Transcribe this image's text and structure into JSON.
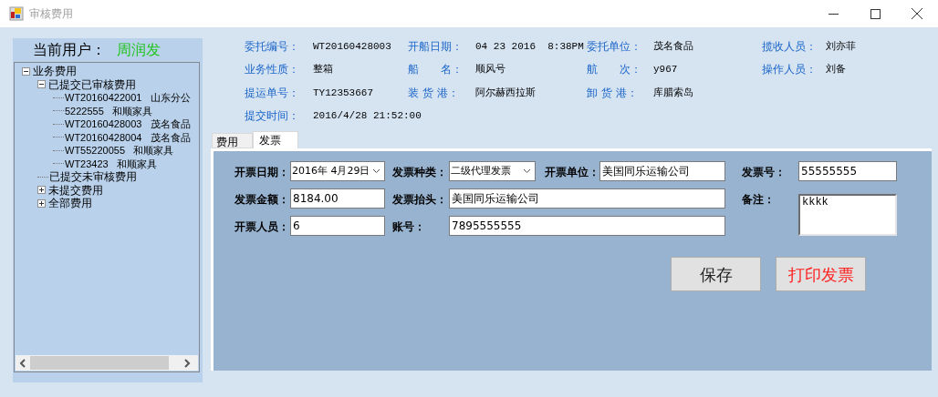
{
  "window": {
    "title": "审核费用"
  },
  "current_user": {
    "label": "当前用户：",
    "name": "周润发"
  },
  "tree": [
    {
      "text": "业务费用",
      "expanded": true,
      "children": [
        {
          "text": "已提交已审核费用",
          "expanded": true,
          "children": [
            {
              "text": "WT20160422001   山东分公"
            },
            {
              "text": "5222555   和顺家具"
            },
            {
              "text": "WT20160428003   茂名食品"
            },
            {
              "text": "WT20160428004   茂名食品"
            },
            {
              "text": "WT55220055   和顺家具"
            },
            {
              "text": "WT23423   和顺家具"
            }
          ]
        },
        {
          "text": "已提交未审核费用"
        },
        {
          "text": "未提交费用",
          "expanded": false
        },
        {
          "text": "全部费用",
          "expanded": false
        }
      ]
    }
  ],
  "info": [
    [
      {
        "label": "委托编号：",
        "value": "WT20160428003"
      },
      {
        "label": "开船日期：",
        "value": "04 23 2016  8:38PM"
      },
      {
        "label": "委托单位：",
        "value": "茂名食品"
      },
      {
        "label": "揽收人员：",
        "value": "刘亦菲"
      }
    ],
    [
      {
        "label": "业务性质：",
        "value": "整箱"
      },
      {
        "label": "船　　名：",
        "value": "顺风号"
      },
      {
        "label": "航　　次：",
        "value": "y967"
      },
      {
        "label": "操作人员：",
        "value": "刘备"
      }
    ],
    [
      {
        "label": "提运单号：",
        "value": "TY12353667"
      },
      {
        "label": "装 货 港：",
        "value": "阿尔赫西拉斯"
      },
      {
        "label": "卸 货 港：",
        "value": "库腊索岛"
      }
    ],
    [
      {
        "label": "提交时间：",
        "value": "2016/4/28 21:52:00"
      }
    ]
  ],
  "tabs": [
    {
      "label": "费用",
      "selected": false
    },
    {
      "label": "发票",
      "selected": true
    }
  ],
  "invoice_form": [
    [
      {
        "label": "开票日期：",
        "value": "2016年 4月29日",
        "kind": "dropdown"
      },
      {
        "label": "发票种类：",
        "value": "二级代理发票",
        "kind": "dropdown"
      },
      {
        "label": "开票单位：",
        "value": "美国同乐运输公司",
        "kind": "text"
      },
      {
        "label": "发票号：",
        "value": "55555555",
        "kind": "text"
      }
    ],
    [
      {
        "label": "发票金额：",
        "value": "8184.00",
        "kind": "text"
      },
      {
        "label": "发票抬头：",
        "value": "美国同乐运输公司",
        "kind": "text"
      },
      {
        "label": "备注：",
        "value": "kkkk",
        "kind": "textarea"
      }
    ],
    [
      {
        "label": "开票人员：",
        "value": "6",
        "kind": "text"
      },
      {
        "label": "账号：",
        "value": "7895555555",
        "kind": "text"
      }
    ]
  ],
  "buttons": [
    {
      "label": "保存",
      "kind": "normal"
    },
    {
      "label": "打印发票",
      "kind": "danger"
    }
  ]
}
